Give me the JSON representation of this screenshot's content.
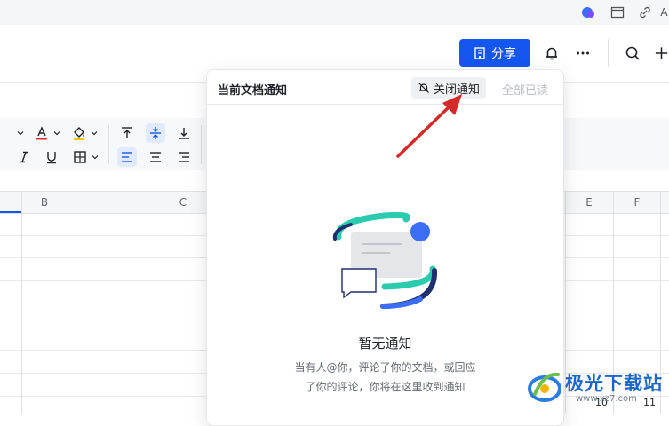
{
  "toolbar": {
    "share_label": "分享"
  },
  "columns": [
    "B",
    "C",
    "E",
    "F"
  ],
  "panel": {
    "title": "当前文档通知",
    "mute_label": "关闭通知",
    "read_all_label": "全部已读",
    "empty_title": "暂无通知",
    "empty_desc_line1": "当有人@你，评论了你的文档，或回应",
    "empty_desc_line2": "了你的评论，你将在这里收到通知"
  },
  "row_numbers_bottom": [
    "10",
    "11"
  ],
  "watermark": {
    "text": "极光下载站",
    "url_text": "www.xz7.com"
  },
  "colors": {
    "accent": "#1456f0",
    "arrow": "#d42a2a",
    "illustration_teal": "#2bcbb0",
    "illustration_navy": "#1e2e6e"
  }
}
